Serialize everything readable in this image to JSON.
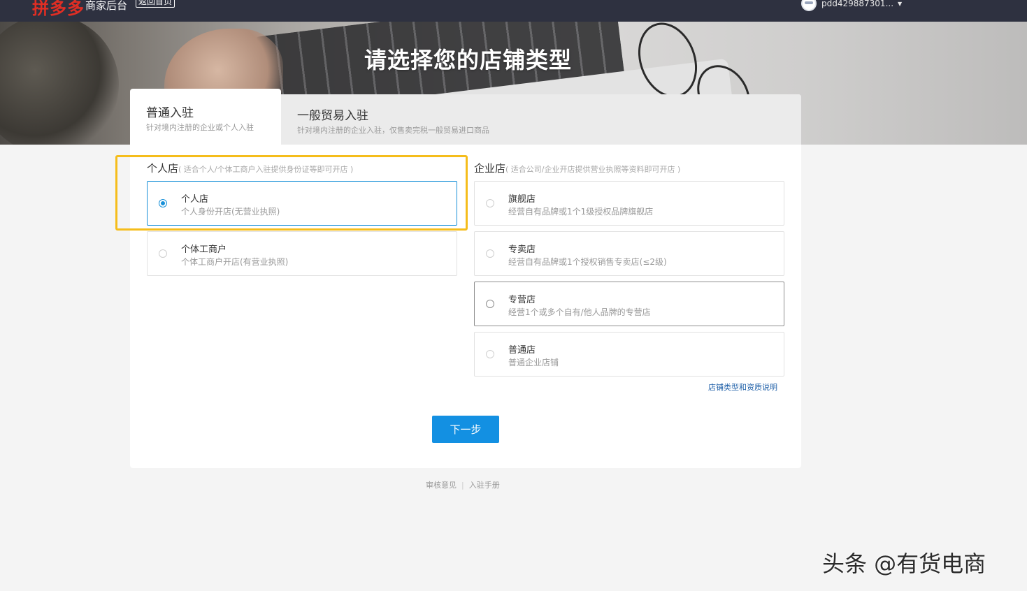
{
  "header": {
    "logo": "拼多多",
    "logo_sub": "商家后台",
    "home_button": "返回首页",
    "user_name": "pdd429887301..."
  },
  "hero": {
    "title": "请选择您的店铺类型"
  },
  "tabs": [
    {
      "title": "普通入驻",
      "desc": "针对境内注册的企业或个人入驻"
    },
    {
      "title": "一般贸易入驻",
      "desc": "针对境内注册的企业入驻，仅售卖完税一般贸易进口商品"
    }
  ],
  "personal": {
    "title": "个人店",
    "hint": "( 适合个人/个体工商户入驻提供身份证等即可开店 )",
    "options": [
      {
        "title": "个人店",
        "desc": "个人身份开店(无营业执照)"
      },
      {
        "title": "个体工商户",
        "desc": "个体工商户开店(有营业执照)"
      }
    ]
  },
  "enterprise": {
    "title": "企业店",
    "hint": "( 适合公司/企业开店提供营业执照等资料即可开店 )",
    "options": [
      {
        "title": "旗舰店",
        "desc": "经营自有品牌或1个1级授权品牌旗舰店"
      },
      {
        "title": "专卖店",
        "desc": "经营自有品牌或1个授权销售专卖店(≤2级)"
      },
      {
        "title": "专营店",
        "desc": "经营1个或多个自有/他人品牌的专营店"
      },
      {
        "title": "普通店",
        "desc": "普通企业店铺"
      }
    ]
  },
  "link": "店铺类型和资质说明",
  "next_button": "下一步",
  "footer": {
    "feedback": "审核意见",
    "manual": "入驻手册"
  },
  "watermark": "头条 @有货电商"
}
